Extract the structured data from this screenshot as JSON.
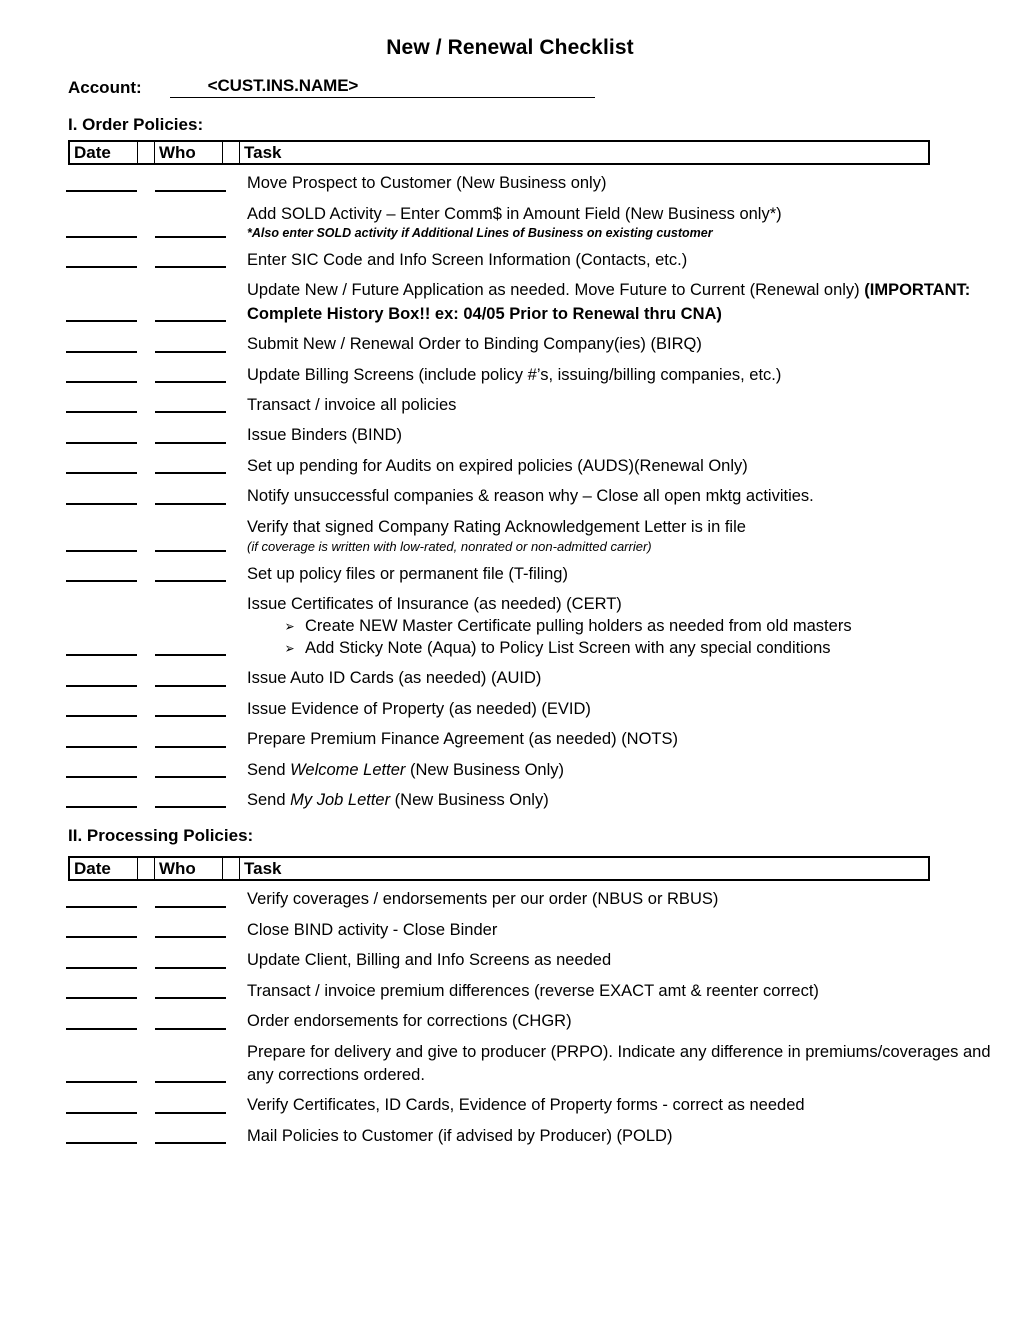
{
  "document": {
    "title": "New / Renewal Checklist",
    "account_label": "Account:",
    "account_value": "<CUST.INS.NAME>"
  },
  "columns": {
    "date": "Date",
    "who": "Who",
    "task": "Task",
    "gap1": "",
    "gap2": ""
  },
  "sections": [
    {
      "heading": "I. Order Policies:",
      "tasks": [
        {
          "main": "Move Prospect to Customer (New Business only)"
        },
        {
          "main": "Add SOLD Activity – Enter Comm$ in Amount Field (New Business only*)",
          "note_bold_italic": "*Also enter SOLD activity if Additional Lines of Business on existing customer"
        },
        {
          "main": "Enter SIC Code and Info Screen Information (Contacts, etc.)"
        },
        {
          "main_prefix": "Update New / Future Application as needed.  Move Future to Current (Renewal only) ",
          "main_bold": "(IMPORTANT:  Complete History Box!! ex:  04/05 Prior to Renewal thru CNA)"
        },
        {
          "main": "Submit New / Renewal Order to Binding Company(ies) (BIRQ)"
        },
        {
          "main": "Update Billing Screens (include policy #’s, issuing/billing companies, etc.)"
        },
        {
          "main": "Transact / invoice all policies"
        },
        {
          "main": "Issue Binders (BIND)"
        },
        {
          "main": "Set up pending for Audits on expired policies (AUDS)(Renewal Only)"
        },
        {
          "main": "Notify unsuccessful companies & reason why – Close all open mktg activities."
        },
        {
          "main": "Verify that signed Company Rating Acknowledgement Letter is in file",
          "note_italic": "(if coverage is written with low-rated, nonrated or non-admitted carrier)"
        },
        {
          "main": "Set up policy files or permanent file (T-filing)"
        },
        {
          "main": "Issue Certificates of Insurance (as needed) (CERT)",
          "bullet_glyph": "➢",
          "bullets": [
            "Create NEW Master Certificate pulling holders as needed from old masters",
            "Add Sticky Note (Aqua) to Policy List Screen with any special conditions"
          ]
        },
        {
          "main": "Issue Auto ID Cards (as needed) (AUID)"
        },
        {
          "main": "Issue Evidence of Property (as needed) (EVID)"
        },
        {
          "main": "Prepare Premium Finance Agreement (as needed) (NOTS)"
        },
        {
          "main_prefix": "Send ",
          "main_italic": "Welcome Letter",
          "main_suffix": " (New Business Only)"
        },
        {
          "main_prefix": "Send ",
          "main_italic": "My Job Letter",
          "main_suffix": " (New Business Only)"
        }
      ]
    },
    {
      "heading": "II. Processing Policies:",
      "tasks": [
        {
          "main": "Verify coverages / endorsements per our order (NBUS or RBUS)"
        },
        {
          "main": "Close BIND activity - Close Binder"
        },
        {
          "main": "Update Client, Billing and Info Screens as needed"
        },
        {
          "main": "Transact / invoice premium differences (reverse EXACT amt & reenter correct)"
        },
        {
          "main": "Order endorsements for corrections (CHGR)"
        },
        {
          "main": "Prepare for delivery and give to producer (PRPO). Indicate any difference in premiums/coverages and any corrections ordered."
        },
        {
          "main": "Verify Certificates, ID Cards, Evidence of Property forms - correct as needed"
        },
        {
          "main": "Mail Policies to Customer (if advised by Producer) (POLD)"
        }
      ]
    }
  ]
}
